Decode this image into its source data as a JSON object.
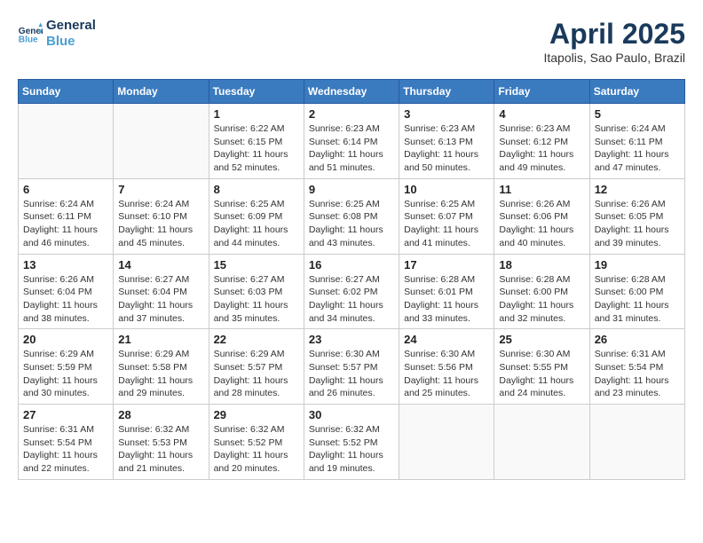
{
  "logo": {
    "line1": "General",
    "line2": "Blue"
  },
  "title": "April 2025",
  "location": "Itapolis, Sao Paulo, Brazil",
  "days_header": [
    "Sunday",
    "Monday",
    "Tuesday",
    "Wednesday",
    "Thursday",
    "Friday",
    "Saturday"
  ],
  "weeks": [
    [
      {
        "day": "",
        "info": ""
      },
      {
        "day": "",
        "info": ""
      },
      {
        "day": "1",
        "info": "Sunrise: 6:22 AM\nSunset: 6:15 PM\nDaylight: 11 hours and 52 minutes."
      },
      {
        "day": "2",
        "info": "Sunrise: 6:23 AM\nSunset: 6:14 PM\nDaylight: 11 hours and 51 minutes."
      },
      {
        "day": "3",
        "info": "Sunrise: 6:23 AM\nSunset: 6:13 PM\nDaylight: 11 hours and 50 minutes."
      },
      {
        "day": "4",
        "info": "Sunrise: 6:23 AM\nSunset: 6:12 PM\nDaylight: 11 hours and 49 minutes."
      },
      {
        "day": "5",
        "info": "Sunrise: 6:24 AM\nSunset: 6:11 PM\nDaylight: 11 hours and 47 minutes."
      }
    ],
    [
      {
        "day": "6",
        "info": "Sunrise: 6:24 AM\nSunset: 6:11 PM\nDaylight: 11 hours and 46 minutes."
      },
      {
        "day": "7",
        "info": "Sunrise: 6:24 AM\nSunset: 6:10 PM\nDaylight: 11 hours and 45 minutes."
      },
      {
        "day": "8",
        "info": "Sunrise: 6:25 AM\nSunset: 6:09 PM\nDaylight: 11 hours and 44 minutes."
      },
      {
        "day": "9",
        "info": "Sunrise: 6:25 AM\nSunset: 6:08 PM\nDaylight: 11 hours and 43 minutes."
      },
      {
        "day": "10",
        "info": "Sunrise: 6:25 AM\nSunset: 6:07 PM\nDaylight: 11 hours and 41 minutes."
      },
      {
        "day": "11",
        "info": "Sunrise: 6:26 AM\nSunset: 6:06 PM\nDaylight: 11 hours and 40 minutes."
      },
      {
        "day": "12",
        "info": "Sunrise: 6:26 AM\nSunset: 6:05 PM\nDaylight: 11 hours and 39 minutes."
      }
    ],
    [
      {
        "day": "13",
        "info": "Sunrise: 6:26 AM\nSunset: 6:04 PM\nDaylight: 11 hours and 38 minutes."
      },
      {
        "day": "14",
        "info": "Sunrise: 6:27 AM\nSunset: 6:04 PM\nDaylight: 11 hours and 37 minutes."
      },
      {
        "day": "15",
        "info": "Sunrise: 6:27 AM\nSunset: 6:03 PM\nDaylight: 11 hours and 35 minutes."
      },
      {
        "day": "16",
        "info": "Sunrise: 6:27 AM\nSunset: 6:02 PM\nDaylight: 11 hours and 34 minutes."
      },
      {
        "day": "17",
        "info": "Sunrise: 6:28 AM\nSunset: 6:01 PM\nDaylight: 11 hours and 33 minutes."
      },
      {
        "day": "18",
        "info": "Sunrise: 6:28 AM\nSunset: 6:00 PM\nDaylight: 11 hours and 32 minutes."
      },
      {
        "day": "19",
        "info": "Sunrise: 6:28 AM\nSunset: 6:00 PM\nDaylight: 11 hours and 31 minutes."
      }
    ],
    [
      {
        "day": "20",
        "info": "Sunrise: 6:29 AM\nSunset: 5:59 PM\nDaylight: 11 hours and 30 minutes."
      },
      {
        "day": "21",
        "info": "Sunrise: 6:29 AM\nSunset: 5:58 PM\nDaylight: 11 hours and 29 minutes."
      },
      {
        "day": "22",
        "info": "Sunrise: 6:29 AM\nSunset: 5:57 PM\nDaylight: 11 hours and 28 minutes."
      },
      {
        "day": "23",
        "info": "Sunrise: 6:30 AM\nSunset: 5:57 PM\nDaylight: 11 hours and 26 minutes."
      },
      {
        "day": "24",
        "info": "Sunrise: 6:30 AM\nSunset: 5:56 PM\nDaylight: 11 hours and 25 minutes."
      },
      {
        "day": "25",
        "info": "Sunrise: 6:30 AM\nSunset: 5:55 PM\nDaylight: 11 hours and 24 minutes."
      },
      {
        "day": "26",
        "info": "Sunrise: 6:31 AM\nSunset: 5:54 PM\nDaylight: 11 hours and 23 minutes."
      }
    ],
    [
      {
        "day": "27",
        "info": "Sunrise: 6:31 AM\nSunset: 5:54 PM\nDaylight: 11 hours and 22 minutes."
      },
      {
        "day": "28",
        "info": "Sunrise: 6:32 AM\nSunset: 5:53 PM\nDaylight: 11 hours and 21 minutes."
      },
      {
        "day": "29",
        "info": "Sunrise: 6:32 AM\nSunset: 5:52 PM\nDaylight: 11 hours and 20 minutes."
      },
      {
        "day": "30",
        "info": "Sunrise: 6:32 AM\nSunset: 5:52 PM\nDaylight: 11 hours and 19 minutes."
      },
      {
        "day": "",
        "info": ""
      },
      {
        "day": "",
        "info": ""
      },
      {
        "day": "",
        "info": ""
      }
    ]
  ]
}
